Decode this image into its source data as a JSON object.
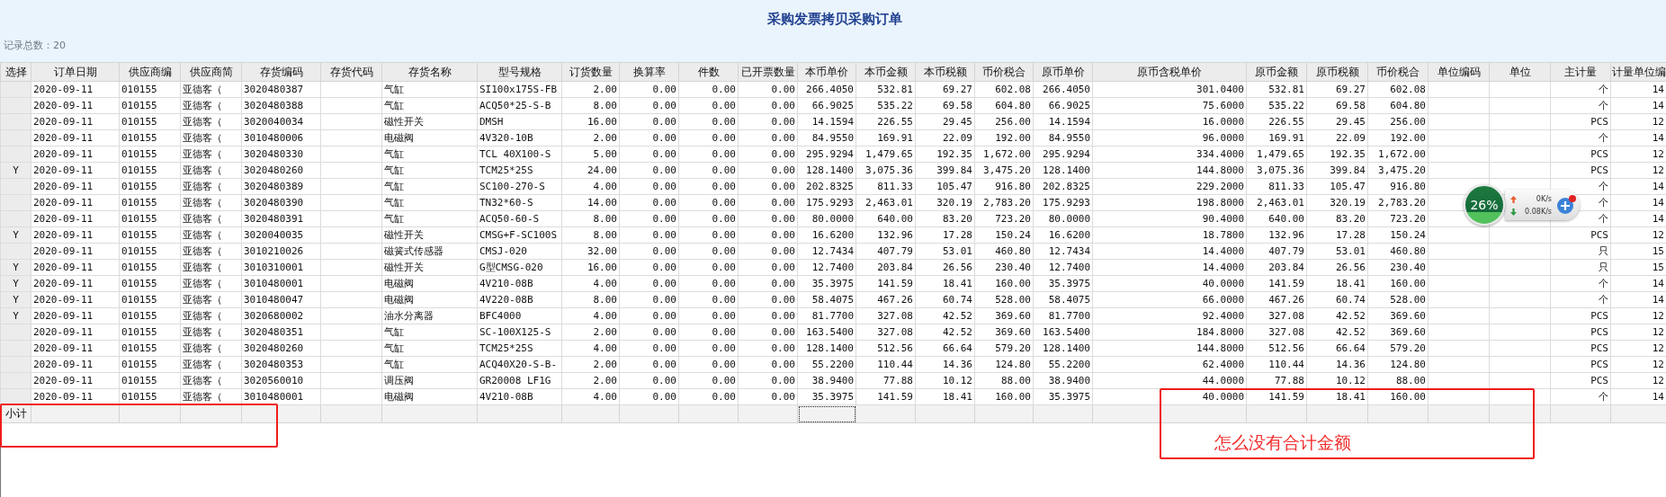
{
  "window": {
    "title": "采购发票拷贝采购订单"
  },
  "record_count": "记录总数：20",
  "columns": [
    {
      "label": "选择",
      "kind": "check",
      "focused": false
    },
    {
      "label": "订单日期",
      "kind": "text",
      "focused": false
    },
    {
      "label": "供应商编",
      "kind": "text",
      "focused": false
    },
    {
      "label": "供应商简",
      "kind": "text",
      "focused": false
    },
    {
      "label": "存货编码",
      "kind": "text",
      "focused": false
    },
    {
      "label": "存货代码",
      "kind": "blank",
      "focused": false
    },
    {
      "label": "存货名称",
      "kind": "text",
      "focused": false
    },
    {
      "label": "型号规格",
      "kind": "text",
      "focused": false
    },
    {
      "label": "订货数量",
      "kind": "number",
      "focused": false
    },
    {
      "label": "换算率",
      "kind": "number",
      "focused": false
    },
    {
      "label": "件数",
      "kind": "number",
      "focused": false
    },
    {
      "label": "已开票数量",
      "kind": "number",
      "focused": false
    },
    {
      "label": "本币单价",
      "kind": "number",
      "focused": true
    },
    {
      "label": "本币金额",
      "kind": "number",
      "focused": false
    },
    {
      "label": "本币税额",
      "kind": "number",
      "focused": false
    },
    {
      "label": "币价税合",
      "kind": "number",
      "focused": false
    },
    {
      "label": "原币单价",
      "kind": "number",
      "focused": false
    },
    {
      "label": "原币含税单价",
      "kind": "number",
      "focused": false
    },
    {
      "label": "原币金额",
      "kind": "number",
      "focused": false
    },
    {
      "label": "原币税额",
      "kind": "number",
      "focused": false
    },
    {
      "label": "币价税合",
      "kind": "number",
      "focused": false
    },
    {
      "label": "单位编码",
      "kind": "blank",
      "focused": false
    },
    {
      "label": "单位",
      "kind": "blank",
      "focused": false
    },
    {
      "label": "主计量",
      "kind": "number",
      "focused": false
    },
    {
      "label": "计量单位编",
      "kind": "number",
      "focused": false
    }
  ],
  "rows": [
    {
      "cells": [
        "2020-09-11",
        "010155",
        "亚德客（",
        "3020480387",
        "气缸",
        "SI100x175S-FB",
        "2.00",
        "0.00",
        "0.00",
        "0.00",
        "266.4050",
        "532.81",
        "69.27",
        "602.08",
        "266.4050",
        "301.0400",
        "532.81",
        "69.27",
        "602.08",
        "个",
        "14"
      ]
    },
    {
      "cells": [
        "2020-09-11",
        "010155",
        "亚德客（",
        "3020480388",
        "气缸",
        "ACQ50*25-S-B",
        "8.00",
        "0.00",
        "0.00",
        "0.00",
        "66.9025",
        "535.22",
        "69.58",
        "604.80",
        "66.9025",
        "75.6000",
        "535.22",
        "69.58",
        "604.80",
        "个",
        "14"
      ]
    },
    {
      "cells": [
        "2020-09-11",
        "010155",
        "亚德客（",
        "3020040034",
        "磁性开关",
        "DMSH",
        "16.00",
        "0.00",
        "0.00",
        "0.00",
        "14.1594",
        "226.55",
        "29.45",
        "256.00",
        "14.1594",
        "16.0000",
        "226.55",
        "29.45",
        "256.00",
        "PCS",
        "12"
      ]
    },
    {
      "cells": [
        "2020-09-11",
        "010155",
        "亚德客（",
        "3010480006",
        "电磁阀",
        "4V320-10B",
        "2.00",
        "0.00",
        "0.00",
        "0.00",
        "84.9550",
        "169.91",
        "22.09",
        "192.00",
        "84.9550",
        "96.0000",
        "169.91",
        "22.09",
        "192.00",
        "个",
        "14"
      ]
    },
    {
      "cells": [
        "2020-09-11",
        "010155",
        "亚德客（",
        "3020480330",
        "气缸",
        "TCL 40X100-S",
        "5.00",
        "0.00",
        "0.00",
        "0.00",
        "295.9294",
        "1,479.65",
        "192.35",
        "1,672.00",
        "295.9294",
        "334.4000",
        "1,479.65",
        "192.35",
        "1,672.00",
        "PCS",
        "12"
      ]
    },
    {
      "select": "Y",
      "cells": [
        "2020-09-11",
        "010155",
        "亚德客（",
        "3020480260",
        "气缸",
        "TCM25*25S",
        "24.00",
        "0.00",
        "0.00",
        "0.00",
        "128.1400",
        "3,075.36",
        "399.84",
        "3,475.20",
        "128.1400",
        "144.8000",
        "3,075.36",
        "399.84",
        "3,475.20",
        "PCS",
        "12"
      ]
    },
    {
      "cells": [
        "2020-09-11",
        "010155",
        "亚德客（",
        "3020480389",
        "气缸",
        "SC100-270-S",
        "4.00",
        "0.00",
        "0.00",
        "0.00",
        "202.8325",
        "811.33",
        "105.47",
        "916.80",
        "202.8325",
        "229.2000",
        "811.33",
        "105.47",
        "916.80",
        "个",
        "14"
      ]
    },
    {
      "cells": [
        "2020-09-11",
        "010155",
        "亚德客（",
        "3020480390",
        "气缸",
        "TN32*60-S",
        "14.00",
        "0.00",
        "0.00",
        "0.00",
        "175.9293",
        "2,463.01",
        "320.19",
        "2,783.20",
        "175.9293",
        "198.8000",
        "2,463.01",
        "320.19",
        "2,783.20",
        "个",
        "14"
      ]
    },
    {
      "cells": [
        "2020-09-11",
        "010155",
        "亚德客（",
        "3020480391",
        "气缸",
        "ACQ50-60-S",
        "8.00",
        "0.00",
        "0.00",
        "0.00",
        "80.0000",
        "640.00",
        "83.20",
        "723.20",
        "80.0000",
        "90.4000",
        "640.00",
        "83.20",
        "723.20",
        "个",
        "14"
      ]
    },
    {
      "select": "Y",
      "cells": [
        "2020-09-11",
        "010155",
        "亚德客（",
        "3020040035",
        "磁性开关",
        "CMSG+F-SC100S",
        "8.00",
        "0.00",
        "0.00",
        "0.00",
        "16.6200",
        "132.96",
        "17.28",
        "150.24",
        "16.6200",
        "18.7800",
        "132.96",
        "17.28",
        "150.24",
        "PCS",
        "12"
      ]
    },
    {
      "cells": [
        "2020-09-11",
        "010155",
        "亚德客（",
        "3010210026",
        "磁簧式传感器",
        "CMSJ-020",
        "32.00",
        "0.00",
        "0.00",
        "0.00",
        "12.7434",
        "407.79",
        "53.01",
        "460.80",
        "12.7434",
        "14.4000",
        "407.79",
        "53.01",
        "460.80",
        "只",
        "15"
      ]
    },
    {
      "select": "Y",
      "cells": [
        "2020-09-11",
        "010155",
        "亚德客（",
        "3010310001",
        "磁性开关",
        "G型CMSG-020",
        "16.00",
        "0.00",
        "0.00",
        "0.00",
        "12.7400",
        "203.84",
        "26.56",
        "230.40",
        "12.7400",
        "14.4000",
        "203.84",
        "26.56",
        "230.40",
        "只",
        "15"
      ]
    },
    {
      "select": "Y",
      "cells": [
        "2020-09-11",
        "010155",
        "亚德客（",
        "3010480001",
        "电磁阀",
        "4V210-08B",
        "4.00",
        "0.00",
        "0.00",
        "0.00",
        "35.3975",
        "141.59",
        "18.41",
        "160.00",
        "35.3975",
        "40.0000",
        "141.59",
        "18.41",
        "160.00",
        "个",
        "14"
      ]
    },
    {
      "select": "Y",
      "cells": [
        "2020-09-11",
        "010155",
        "亚德客（",
        "3010480047",
        "电磁阀",
        "4V220-08B",
        "8.00",
        "0.00",
        "0.00",
        "0.00",
        "58.4075",
        "467.26",
        "60.74",
        "528.00",
        "58.4075",
        "66.0000",
        "467.26",
        "60.74",
        "528.00",
        "个",
        "14"
      ]
    },
    {
      "select": "Y",
      "cells": [
        "2020-09-11",
        "010155",
        "亚德客（",
        "3020680002",
        "油水分离器",
        "BFC4000",
        "4.00",
        "0.00",
        "0.00",
        "0.00",
        "81.7700",
        "327.08",
        "42.52",
        "369.60",
        "81.7700",
        "92.4000",
        "327.08",
        "42.52",
        "369.60",
        "PCS",
        "12"
      ]
    },
    {
      "cells": [
        "2020-09-11",
        "010155",
        "亚德客（",
        "3020480351",
        "气缸",
        "SC-100X125-S",
        "2.00",
        "0.00",
        "0.00",
        "0.00",
        "163.5400",
        "327.08",
        "42.52",
        "369.60",
        "163.5400",
        "184.8000",
        "327.08",
        "42.52",
        "369.60",
        "PCS",
        "12"
      ]
    },
    {
      "cells": [
        "2020-09-11",
        "010155",
        "亚德客（",
        "3020480260",
        "气缸",
        "TCM25*25S",
        "4.00",
        "0.00",
        "0.00",
        "0.00",
        "128.1400",
        "512.56",
        "66.64",
        "579.20",
        "128.1400",
        "144.8000",
        "512.56",
        "66.64",
        "579.20",
        "PCS",
        "12"
      ]
    },
    {
      "cells": [
        "2020-09-11",
        "010155",
        "亚德客（",
        "3020480353",
        "气缸",
        "ACQ40X20-S-B-",
        "2.00",
        "0.00",
        "0.00",
        "0.00",
        "55.2200",
        "110.44",
        "14.36",
        "124.80",
        "55.2200",
        "62.4000",
        "110.44",
        "14.36",
        "124.80",
        "PCS",
        "12"
      ]
    },
    {
      "cells": [
        "2020-09-11",
        "010155",
        "亚德客（",
        "3020560010",
        "调压阀",
        "GR20008 LF1G",
        "2.00",
        "0.00",
        "0.00",
        "0.00",
        "38.9400",
        "77.88",
        "10.12",
        "88.00",
        "38.9400",
        "44.0000",
        "77.88",
        "10.12",
        "88.00",
        "PCS",
        "12"
      ]
    },
    {
      "cells": [
        "2020-09-11",
        "010155",
        "亚德客（",
        "3010480001",
        "电磁阀",
        "4V210-08B",
        "4.00",
        "0.00",
        "0.00",
        "0.00",
        "35.3975",
        "141.59",
        "18.41",
        "160.00",
        "35.3975",
        "40.0000",
        "141.59",
        "18.41",
        "160.00",
        "个",
        "14"
      ]
    }
  ],
  "summary": {
    "label": "小计"
  },
  "annotation": {
    "note": "怎么没有合计金额"
  },
  "network_widget": {
    "usage": "26%",
    "upload": "0K/s",
    "download": "0.08K/s"
  }
}
